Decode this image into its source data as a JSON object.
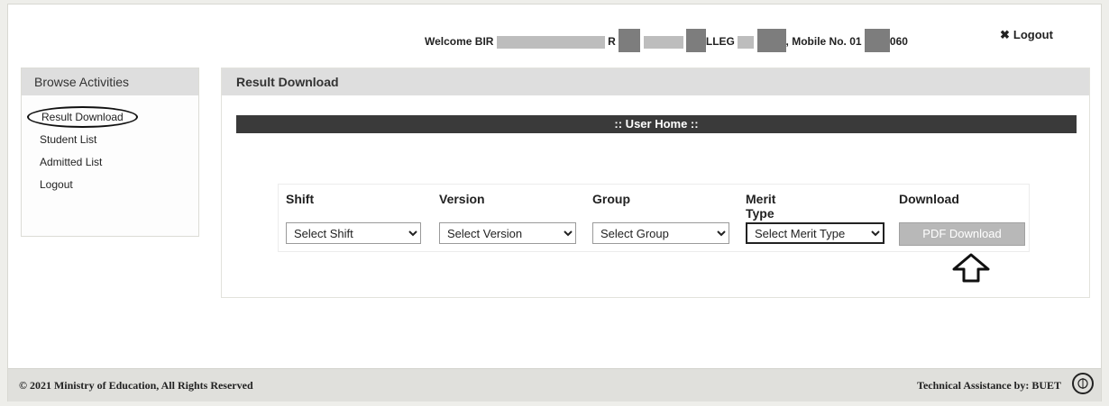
{
  "header": {
    "welcome_prefix": "Welcome BIR",
    "welcome_mid1": "R",
    "welcome_mid2": "LLEG",
    "mobile_label": ", Mobile No. 01",
    "mobile_suffix": "060",
    "logout_label": "Logout",
    "logout_icon": "close-icon"
  },
  "sidebar": {
    "title": "Browse Activities",
    "items": [
      {
        "label": "Result Download"
      },
      {
        "label": "Student List"
      },
      {
        "label": "Admitted List"
      },
      {
        "label": "Logout"
      }
    ]
  },
  "main": {
    "title": "Result Download",
    "banner": ":: User Home ::",
    "columns": {
      "shift": "Shift",
      "version": "Version",
      "group": "Group",
      "merit_type": "Merit Type",
      "download": "Download"
    },
    "selects": {
      "shift": "Select Shift",
      "version": "Select Version",
      "group": "Select Group",
      "merit_type": "Select Merit Type"
    },
    "download_button": "PDF Download",
    "annotation_icon": "up-arrow-icon"
  },
  "footer": {
    "copyright": "© 2021 Ministry of Education, All Rights Reserved",
    "technical": "Technical Assistance by: BUET"
  }
}
